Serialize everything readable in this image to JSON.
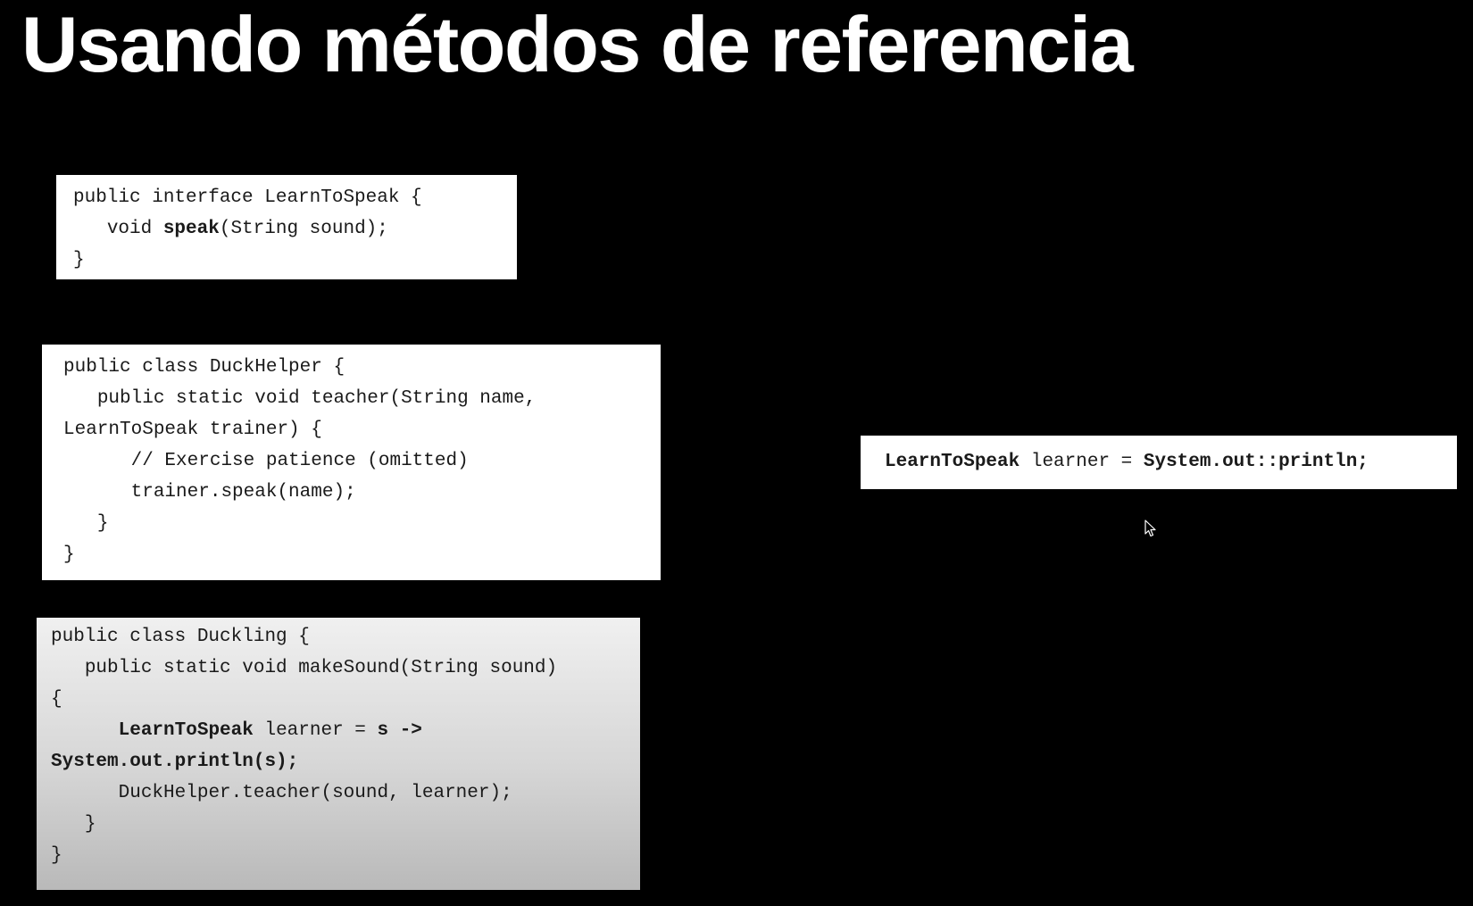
{
  "slide": {
    "title": "Usando métodos de referencia"
  },
  "interface_box": {
    "lines": [
      {
        "indent": "",
        "parts": [
          {
            "t": "public interface LearnToSpeak {",
            "b": false
          }
        ]
      },
      {
        "indent": "   ",
        "parts": [
          {
            "t": "void ",
            "b": false
          },
          {
            "t": "speak",
            "b": true
          },
          {
            "t": "(String sound);",
            "b": false
          }
        ]
      },
      {
        "indent": "",
        "parts": [
          {
            "t": "}",
            "b": false
          }
        ]
      }
    ]
  },
  "duckhelper_box": {
    "lines": [
      {
        "indent": "",
        "parts": [
          {
            "t": "public class DuckHelper {",
            "b": false
          }
        ]
      },
      {
        "indent": "   ",
        "parts": [
          {
            "t": "public static void teacher(String name,",
            "b": false
          }
        ]
      },
      {
        "indent": "",
        "parts": [
          {
            "t": "LearnToSpeak trainer) {",
            "b": false
          }
        ]
      },
      {
        "indent": "      ",
        "parts": [
          {
            "t": "// Exercise patience (omitted)",
            "b": false
          }
        ]
      },
      {
        "indent": "      ",
        "parts": [
          {
            "t": "trainer.speak(name);",
            "b": false
          }
        ]
      },
      {
        "indent": "   ",
        "parts": [
          {
            "t": "}",
            "b": false
          }
        ]
      },
      {
        "indent": "",
        "parts": [
          {
            "t": "}",
            "b": false
          }
        ]
      }
    ]
  },
  "duckling_box": {
    "lines": [
      {
        "indent": "",
        "parts": [
          {
            "t": "public class Duckling {",
            "b": false
          }
        ]
      },
      {
        "indent": "   ",
        "parts": [
          {
            "t": "public static void makeSound(String sound)",
            "b": false
          }
        ]
      },
      {
        "indent": "",
        "parts": [
          {
            "t": "{",
            "b": false
          }
        ]
      },
      {
        "indent": "      ",
        "parts": [
          {
            "t": "LearnToSpeak",
            "b": true
          },
          {
            "t": " learner = ",
            "b": false
          },
          {
            "t": "s ->",
            "b": true
          }
        ]
      },
      {
        "indent": "",
        "parts": [
          {
            "t": "System.out.println(s);",
            "b": true
          }
        ]
      },
      {
        "indent": "      ",
        "parts": [
          {
            "t": "DuckHelper.teacher(sound, learner);",
            "b": false
          }
        ]
      },
      {
        "indent": "   ",
        "parts": [
          {
            "t": "}",
            "b": false
          }
        ]
      },
      {
        "indent": "",
        "parts": [
          {
            "t": "}",
            "b": false
          }
        ]
      }
    ]
  },
  "method_ref_box": {
    "lines": [
      {
        "indent": "",
        "parts": [
          {
            "t": "LearnToSpeak",
            "b": true
          },
          {
            "t": " learner = ",
            "b": false
          },
          {
            "t": "System.out::println;",
            "b": true
          }
        ]
      }
    ]
  },
  "icons": {
    "cursor": "mouse-pointer-icon"
  }
}
